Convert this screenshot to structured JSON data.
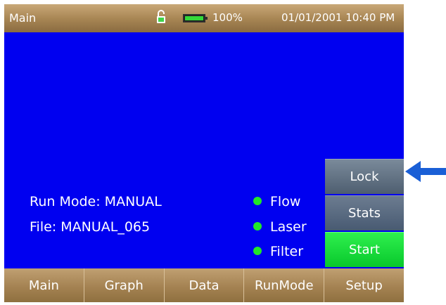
{
  "status_bar": {
    "title": "Main",
    "lock_icon": "unlocked-padlock-icon",
    "battery_icon": "battery-icon",
    "battery_level": 1.0,
    "battery_text": "100%",
    "datetime": "01/01/2001 10:40 PM"
  },
  "main": {
    "run_mode": "Run Mode: MANUAL",
    "file": "File: MANUAL_065",
    "status_items": [
      {
        "label": "Flow",
        "color": "#21e828"
      },
      {
        "label": "Laser",
        "color": "#21e828"
      },
      {
        "label": "Filter",
        "color": "#21e828"
      }
    ]
  },
  "side_buttons": {
    "lock": "Lock",
    "stats": "Stats",
    "start": "Start"
  },
  "nav": {
    "items": [
      "Main",
      "Graph",
      "Data",
      "RunMode",
      "Setup"
    ]
  },
  "colors": {
    "screen_bg": "#0000f0",
    "accent_arrow": "#1a5fd6",
    "start_green": "#11d436"
  }
}
